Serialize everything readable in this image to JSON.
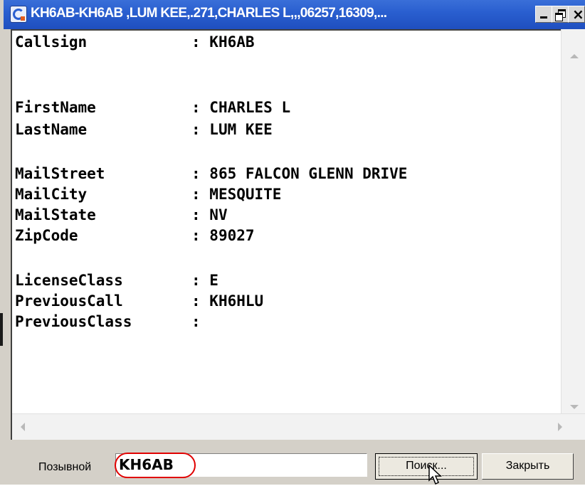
{
  "window": {
    "title": "KH6AB-KH6AB ,LUM KEE,.271,CHARLES L,,,06257,16309,..."
  },
  "record": [
    {
      "key": "Callsign",
      "sep": ": ",
      "value": "KH6AB"
    },
    {
      "key": "FirstName",
      "sep": ": ",
      "value": "CHARLES L"
    },
    {
      "key": "LastName",
      "sep": ": ",
      "value": "LUM KEE"
    },
    {
      "key": "MailStreet",
      "sep": ": ",
      "value": "865 FALCON GLENN DRIVE"
    },
    {
      "key": "MailCity",
      "sep": ": ",
      "value": "MESQUITE"
    },
    {
      "key": "MailState",
      "sep": ": ",
      "value": "NV"
    },
    {
      "key": "ZipCode",
      "sep": ": ",
      "value": "89027"
    },
    {
      "key": "LicenseClass",
      "sep": ": ",
      "value": "E"
    },
    {
      "key": "PreviousCall",
      "sep": ": ",
      "value": "KH6HLU"
    },
    {
      "key": "PreviousClass",
      "sep": ":",
      "value": ""
    }
  ],
  "bottom": {
    "callsign_label": "Позывной",
    "callsign_value": "KH6AB",
    "search_label": "Поиск...",
    "close_label": "Закрыть"
  },
  "colors": {
    "title_bar": "#2a5fd0",
    "highlight_ring": "#e00000"
  }
}
